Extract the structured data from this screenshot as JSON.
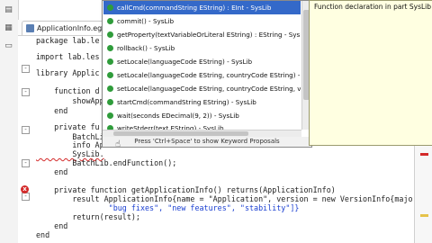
{
  "tab": {
    "label": "ApplicationInfo.egl",
    "close_glyph": "×"
  },
  "code_lines": [
    "package lab.le",
    "",
    "import lab.les",
    "",
    "library Applic",
    "",
    "    function d",
    "        showApp",
    "    end",
    "",
    "    private fu",
    "        BatchLi",
    "        info Ap",
    "        SysLib.",
    "        BatchLib.endFunction();",
    "    end",
    "",
    "    private function getApplicationInfo() returns(ApplicationInfo)",
    "        result ApplicationInfo{name = \"Application\", version = new VersionInfo{major =",
    "                \"bug fixes\", \"new features\", \"stability\"]}",
    "        return(result);",
    "    end",
    "end"
  ],
  "assist": {
    "items": [
      "callCmd(commandString EString) : EInt - SysLib",
      "commit() - SysLib",
      "getProperty(textVariableOrLiteral EString) : EString - SysLib",
      "rollback() - SysLib",
      "setLocale(languageCode EString) - SysLib",
      "setLocale(languageCode EString, countryCode EString) - SysLib",
      "setLocale(languageCode EString, countryCode EString, vari",
      "startCmd(commandString EString) - SysLib",
      "wait(seconds EDecimal(9, 2)) - SysLib",
      "writeStderr(text EString) - SysLib"
    ],
    "hint": "Press 'Ctrl+Space' to show Keyword Proposals"
  },
  "doc": {
    "text": "Function declaration in part SysLib"
  },
  "colors": {
    "selection": "#3469c9",
    "doc_bg": "#ffffe1",
    "error": "#d32a2a"
  }
}
